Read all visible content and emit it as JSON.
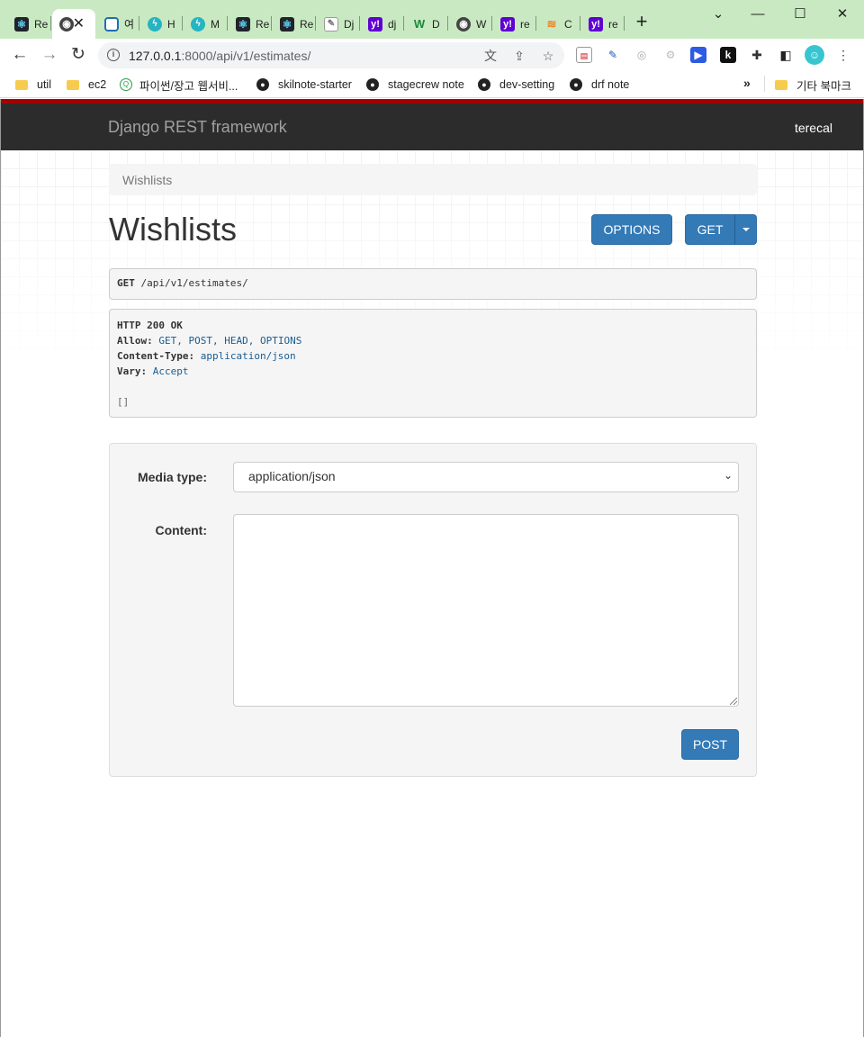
{
  "browser": {
    "tabs": [
      {
        "icon": "react-icon",
        "title": "Re",
        "active": false
      },
      {
        "icon": "globe-icon",
        "title": "",
        "active": true
      },
      {
        "icon": "app-icon",
        "title": "여",
        "active": false
      },
      {
        "icon": "bolt-icon",
        "title": "H",
        "active": false
      },
      {
        "icon": "bolt-icon",
        "title": "M",
        "active": false
      },
      {
        "icon": "react-icon",
        "title": "Re",
        "active": false
      },
      {
        "icon": "react-icon",
        "title": "Re",
        "active": false
      },
      {
        "icon": "doc-icon",
        "title": "Dj",
        "active": false
      },
      {
        "icon": "yahoo-icon",
        "title": "dj",
        "active": false
      },
      {
        "icon": "w-icon",
        "title": "D",
        "active": false
      },
      {
        "icon": "globe-icon",
        "title": "W",
        "active": false
      },
      {
        "icon": "yahoo-icon",
        "title": "re",
        "active": false
      },
      {
        "icon": "stackoverflow-icon",
        "title": "C",
        "active": false
      },
      {
        "icon": "yahoo-icon",
        "title": "re",
        "active": false
      }
    ],
    "url_host": "127.0.0.1",
    "url_path": ":8000/api/v1/estimates/",
    "bookmarks": [
      {
        "icon": "folder-icon",
        "label": "util"
      },
      {
        "icon": "folder-icon",
        "label": "ec2"
      },
      {
        "icon": "q-icon",
        "label": "파이썬/장고 웹서비..."
      },
      {
        "icon": "github-icon",
        "label": "skilnote-starter"
      },
      {
        "icon": "github-icon",
        "label": "stagecrew note"
      },
      {
        "icon": "github-icon",
        "label": "dev-setting"
      },
      {
        "icon": "github-icon",
        "label": "drf note"
      }
    ],
    "bookmarks_more": "»",
    "other_bookmarks": "기타 북마크"
  },
  "drf": {
    "brand": "Django REST framework",
    "user": "terecal",
    "breadcrumb": "Wishlists",
    "title": "Wishlists",
    "options_label": "OPTIONS",
    "get_label": "GET",
    "request_method": "GET",
    "request_path": "/api/v1/estimates/",
    "response": {
      "status": "HTTP 200 OK",
      "headers": [
        {
          "key": "Allow:",
          "value": "GET, POST, HEAD, OPTIONS"
        },
        {
          "key": "Content-Type:",
          "value": "application/json"
        },
        {
          "key": "Vary:",
          "value": "Accept"
        }
      ],
      "body": "[]"
    },
    "form": {
      "media_type_label": "Media type:",
      "media_type_value": "application/json",
      "content_label": "Content:",
      "content_value": "",
      "post_label": "POST"
    }
  },
  "colors": {
    "navbar_bg": "#2c2c2c",
    "navbar_accent": "#a30000",
    "button_primary": "#337ab7",
    "tabstrip_bg": "#c9e9c2"
  }
}
